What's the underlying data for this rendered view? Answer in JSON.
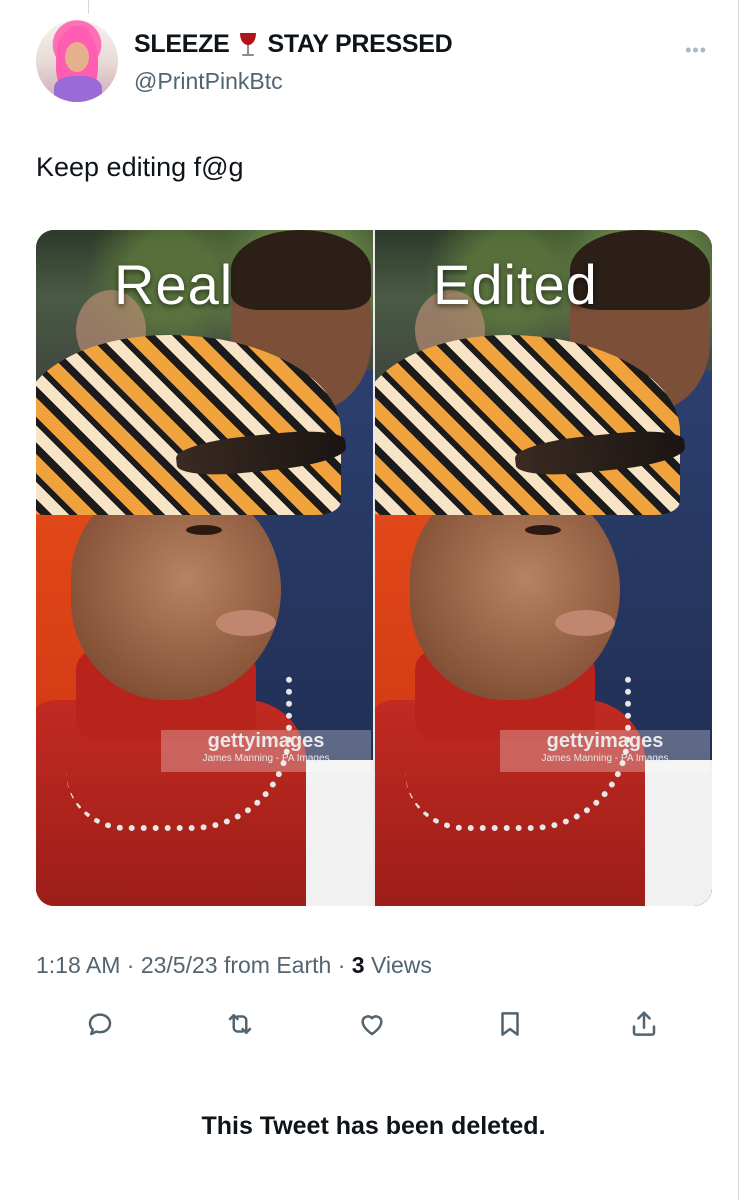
{
  "tweet": {
    "display_name_left": "SLEEZE",
    "display_name_right": "STAY PRESSED",
    "name_emoji_icon": "wine-glass-icon",
    "handle": "@PrintPinkBtc",
    "text": "Keep editing f@g",
    "more_icon": "more-dots-icon"
  },
  "media": {
    "left_label": "Real",
    "right_label": "Edited",
    "watermark_main": "gettyimages",
    "watermark_sub": "James Manning - PA Images"
  },
  "meta": {
    "time_date": "1:18 AM · 23/5/23 from Earth · ",
    "views_count": "3",
    "views_label": " Views"
  },
  "actions": [
    {
      "icon": "reply-icon"
    },
    {
      "icon": "retweet-icon"
    },
    {
      "icon": "like-heart-icon"
    },
    {
      "icon": "bookmark-icon"
    },
    {
      "icon": "share-icon"
    }
  ],
  "notice": {
    "deleted_text": "This Tweet has been deleted."
  },
  "colors": {
    "text_primary": "#0f1419",
    "text_secondary": "#536471",
    "icon": "#536471"
  }
}
